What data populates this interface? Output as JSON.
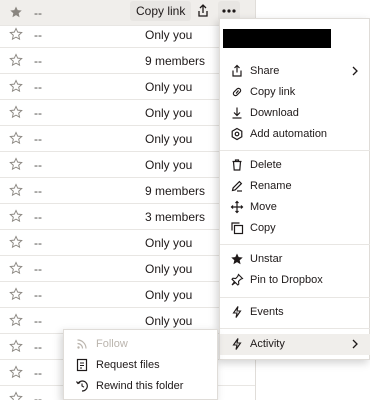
{
  "rows": [
    {
      "name": "--",
      "access": "",
      "starred": true,
      "selected": true
    },
    {
      "name": "--",
      "access": "Only you",
      "starred": false
    },
    {
      "name": "--",
      "access": "9 members",
      "starred": false
    },
    {
      "name": "--",
      "access": "Only you",
      "starred": false
    },
    {
      "name": "--",
      "access": "Only you",
      "starred": false
    },
    {
      "name": "--",
      "access": "Only you",
      "starred": false
    },
    {
      "name": "--",
      "access": "Only you",
      "starred": false
    },
    {
      "name": "--",
      "access": "9 members",
      "starred": false
    },
    {
      "name": "--",
      "access": "3 members",
      "starred": false
    },
    {
      "name": "--",
      "access": "Only you",
      "starred": false
    },
    {
      "name": "--",
      "access": "Only you",
      "starred": false
    },
    {
      "name": "--",
      "access": "Only you",
      "starred": false
    },
    {
      "name": "--",
      "access": "Only you",
      "starred": false
    },
    {
      "name": "--",
      "access": "",
      "starred": false
    },
    {
      "name": "--",
      "access": "",
      "starred": false
    },
    {
      "name": "--",
      "access": "",
      "starred": false
    }
  ],
  "toolbar": {
    "copy_link": "Copy link",
    "share_icon": "share-arrow-icon",
    "more_icon": "more-dots-icon"
  },
  "menu": {
    "items": [
      {
        "label": "Share",
        "icon": "share-icon",
        "submenu": true
      },
      {
        "label": "Copy link",
        "icon": "link-icon"
      },
      {
        "label": "Download",
        "icon": "download-icon"
      },
      {
        "label": "Add automation",
        "icon": "automation-gear-icon"
      },
      {
        "label": "Delete",
        "icon": "trash-icon"
      },
      {
        "label": "Rename",
        "icon": "pencil-icon"
      },
      {
        "label": "Move",
        "icon": "move-arrows-icon"
      },
      {
        "label": "Copy",
        "icon": "copy-icon"
      },
      {
        "label": "Unstar",
        "icon": "star-filled-icon"
      },
      {
        "label": "Pin to Dropbox",
        "icon": "pin-icon"
      },
      {
        "label": "Events",
        "icon": "lightning-icon"
      },
      {
        "label": "Activity",
        "icon": "activity-icon",
        "submenu": true,
        "active": true
      }
    ]
  },
  "submenu": {
    "items": [
      {
        "label": "Follow",
        "icon": "rss-icon",
        "disabled": true
      },
      {
        "label": "Request files",
        "icon": "request-files-icon"
      },
      {
        "label": "Rewind this folder",
        "icon": "rewind-icon"
      }
    ]
  },
  "colors": {
    "text": "#1e1919",
    "muted": "#52504c",
    "selected_row": "#f0eeeb",
    "disabled": "#bbb5ae",
    "border": "#e8e6e3"
  }
}
